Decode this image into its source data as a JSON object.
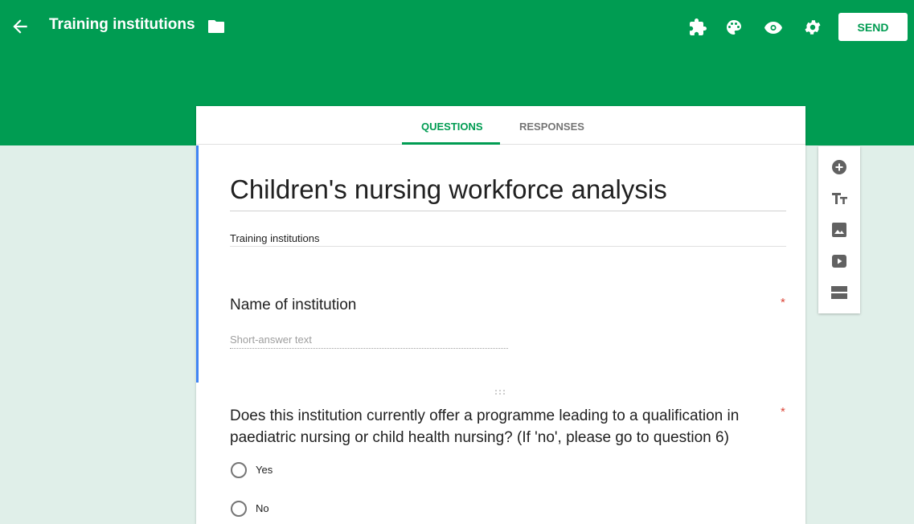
{
  "app": {
    "title": "Training institutions",
    "send_label": "SEND"
  },
  "toolbar": {
    "icons": [
      "back-arrow-icon",
      "folder-icon",
      "addons-puzzle-icon",
      "palette-icon",
      "preview-eye-icon",
      "settings-gear-icon"
    ]
  },
  "tabs": [
    {
      "label": "QUESTIONS",
      "active": true
    },
    {
      "label": "RESPONSES",
      "active": false
    }
  ],
  "form": {
    "title": "Children's nursing workforce analysis",
    "description": "Training institutions"
  },
  "questions": [
    {
      "title": "Name of institution",
      "required_mark": "*",
      "placeholder": "Short-answer text"
    },
    {
      "title": "Does this institution currently offer a programme leading to a qualification in paediatric nursing or child health nursing? (If 'no', please go to question 6)",
      "required_mark": "*",
      "options": [
        "Yes",
        "No"
      ]
    }
  ],
  "side_toolbar": {
    "icons": [
      "add-question-icon",
      "add-title-icon",
      "add-image-icon",
      "add-video-icon",
      "add-section-icon"
    ]
  },
  "colors": {
    "header": "#009c52",
    "background": "#e0efe9",
    "accent_focus": "#4285f4",
    "required": "#db4437"
  }
}
